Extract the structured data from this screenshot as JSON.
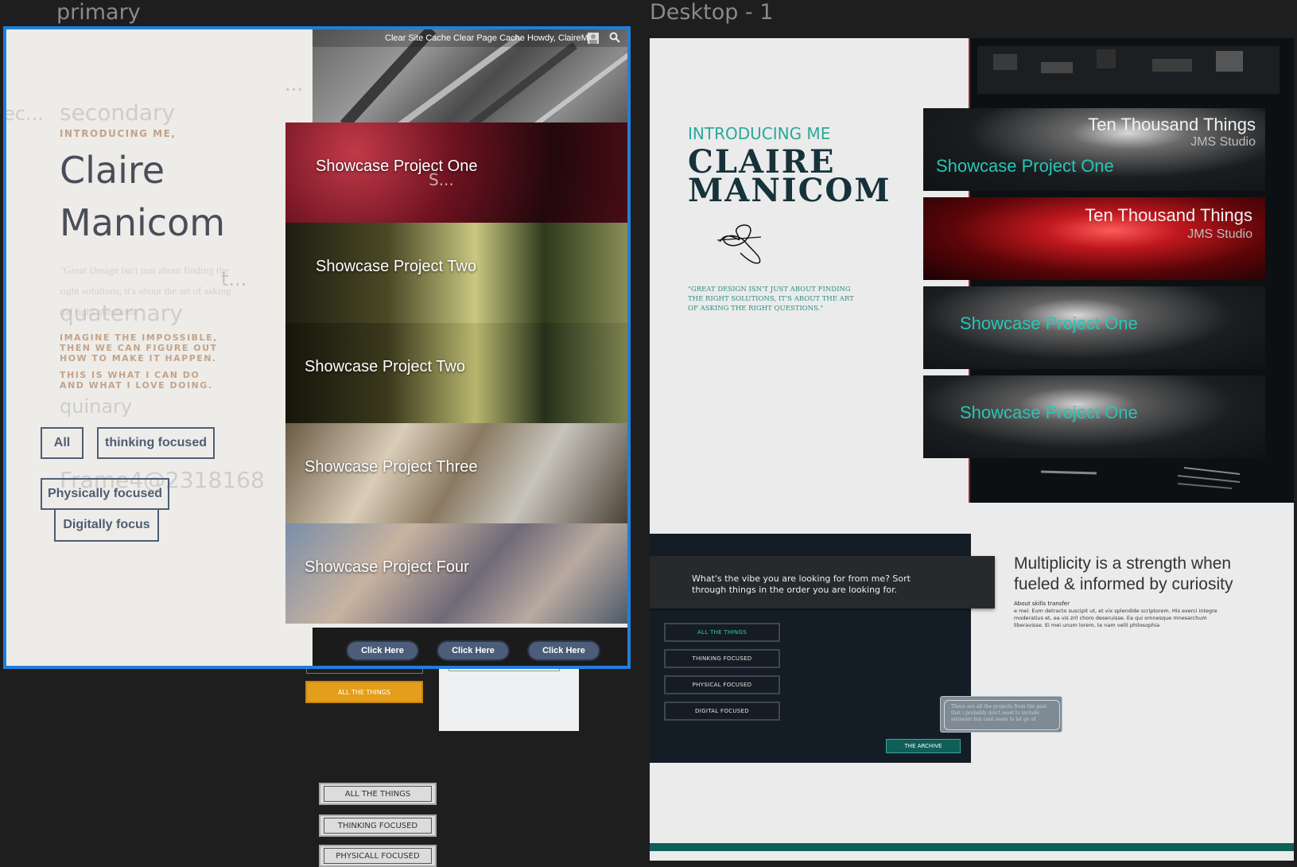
{
  "canvas": {
    "left_frame_label": "primary",
    "right_frame_label": "Desktop - 1",
    "ghost_labels": {
      "secondary": "secondary",
      "quaternary": "quaternary",
      "quinary": "quinary",
      "frame_id": "Frame4@2318168",
      "ellipsis_1": "...",
      "ellipsis_2": "S...",
      "ellipsis_3": "t...",
      "ellipsis_4": "...",
      "ec": "ec..."
    }
  },
  "left": {
    "intro": "INTRODUCING ME,",
    "name_line1": "Claire",
    "name_line2": "Manicom",
    "faded_quote": "\"Great Design isn't just about finding the right solutions, it's about the art of asking the right questions.\"",
    "statement1": "IMAGINE THE IMPOSSIBLE, THEN WE CAN FIGURE OUT HOW TO MAKE IT HAPPEN.",
    "statement2": "THIS IS WHAT I CAN DO AND WHAT I LOVE DOING.",
    "filters": {
      "all": "All",
      "thinking": "thinking focused",
      "physical": "Physically focused",
      "digital": "Digitally focus"
    },
    "wp_bar": {
      "clear_site": "Clear Site Cache",
      "clear_page": "Clear Page Cache",
      "howdy": "Howdy, ClaireM"
    },
    "showcases": [
      "Showcase Project One",
      "Showcase Project Two",
      "Showcase Project Two",
      "Showcase Project Three",
      "Showcase Project Four"
    ],
    "click_buttons": [
      "Click Here",
      "Click Here",
      "Click Here"
    ]
  },
  "below_left": {
    "orange_button": "ALL THE THINGS",
    "gray_buttons": [
      "ALL THE THINGS",
      "THINKING FOCUSED",
      "PHYSICALL FOCUSED"
    ]
  },
  "right": {
    "intro": "INTRODUCING ME",
    "name_line1": "CLAIRE",
    "name_line2": "MANICOM",
    "quote": "\"GREAT DESIGN ISN'T JUST ABOUT FINDING THE RIGHT SOLUTIONS, IT'S ABOUT THE ART OF ASKING THE RIGHT QUESTIONS.\"",
    "cards": [
      {
        "title": "Ten Thousand Things",
        "subtitle": "JMS Studio",
        "project": "Showcase Project One"
      },
      {
        "title": "Ten Thousand Things",
        "subtitle": "JMS Studio",
        "project": ""
      },
      {
        "title": "",
        "subtitle": "",
        "project": "Showcase Project One"
      },
      {
        "title": "",
        "subtitle": "",
        "project": "Showcase Project One"
      }
    ],
    "vibe_text": "What's the vibe you are looking for from me? Sort through things in the order you are looking for.",
    "filter_buttons": [
      "ALL THE THINGS",
      "THINKING FOCUSED",
      "PHYSICAL FOCUSED",
      "DIGITAL FOCUSED"
    ],
    "archive_note": "These are all the projects from the past that i probably don't need to include anymore but cant seem to let go of",
    "archive_button": "THE ARCHIVE",
    "heading": "Multiplicity is a strength when fueled & informed by curiosity",
    "about_label": "About skills transfer",
    "about_body": "e mel. Eum detracto suscipit ut, et vix splendide scriptorem. His exerci integre moderatius et, ea vis zril choro deseruisse. Ea qui omnesque mnesarchum liberavisse. Ei mei unum lorem, te nam velit philosophia",
    "colors": {
      "teal": "#2aa89a",
      "navy": "#16323a",
      "dark_panel": "#141d26",
      "accent_bar": "#0f5e57"
    }
  }
}
